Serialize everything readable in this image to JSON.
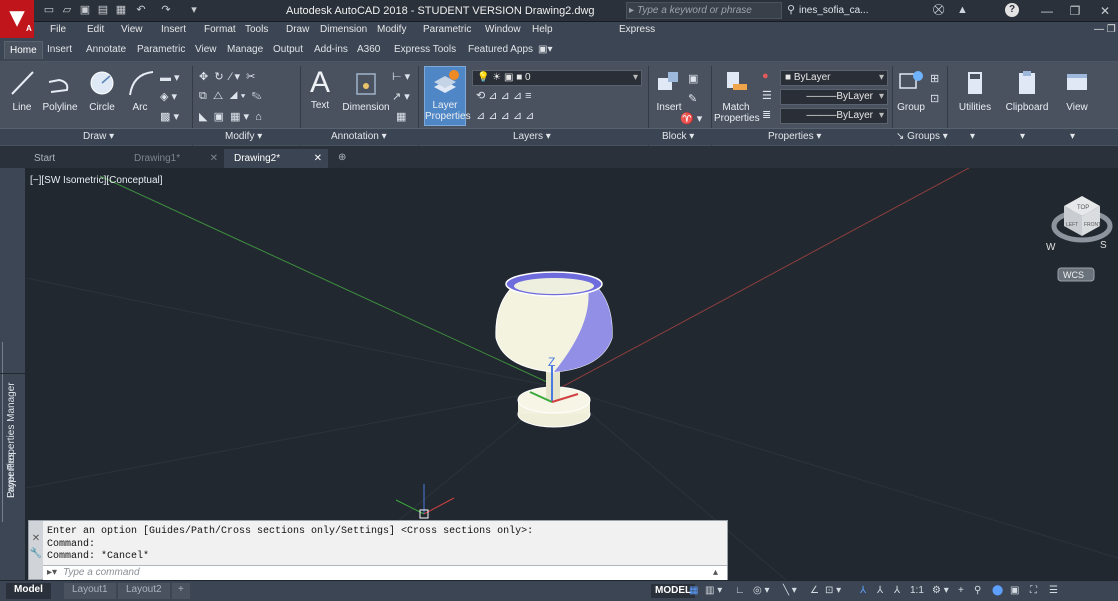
{
  "app": {
    "logo_letter": "A",
    "title": "Autodesk AutoCAD 2018 - STUDENT VERSION    Drawing2.dwg",
    "search_placeholder": "Type a keyword or phrase",
    "user": "ines_sofia_ca...",
    "help": "?"
  },
  "menu": [
    "File",
    "Edit",
    "View",
    "Insert",
    "Format",
    "Tools",
    "Draw",
    "Dimension",
    "Modify",
    "Parametric",
    "Window",
    "Help",
    "Express"
  ],
  "ribbon_tabs": [
    "Home",
    "Insert",
    "Annotate",
    "Parametric",
    "View",
    "Manage",
    "Output",
    "Add-ins",
    "A360",
    "Express Tools",
    "Featured Apps"
  ],
  "draw_tools": [
    "Line",
    "Polyline",
    "Circle",
    "Arc"
  ],
  "text_tools": [
    "Text",
    "Dimension"
  ],
  "layer_button": "Layer Properties",
  "layer_current": "0",
  "insert_button": "Insert",
  "match_button": "Match Properties",
  "properties": {
    "color": "ByLayer",
    "linetype": "ByLayer",
    "lineweight": "ByLayer"
  },
  "group_button": "Group",
  "utilities_button": "Utilities",
  "clipboard_button": "Clipboard",
  "view_button": "View",
  "panels": [
    "Draw",
    "Modify",
    "Annotation",
    "Layers",
    "Block",
    "Properties",
    "Groups"
  ],
  "doc_tabs": [
    "Start",
    "Drawing1*",
    "Drawing2*"
  ],
  "palettes": {
    "layer_manager": "Layer Properties Manager",
    "properties": "Properties"
  },
  "viewport": {
    "label": "[−][SW Isometric][Conceptual]",
    "ucs_label": "Z",
    "wcs": "WCS",
    "cube_top": "TOP",
    "cube_left": "LEFT",
    "cube_front": "FRONT",
    "compass_w": "W",
    "compass_s": "S"
  },
  "command": {
    "lines": [
      "Enter an option [Guides/Path/Cross sections only/Settings] <Cross sections only>:",
      "Command:",
      "Command: *Cancel*"
    ],
    "input_placeholder": "Type a command"
  },
  "layout_tabs": [
    "Model",
    "Layout1",
    "Layout2"
  ],
  "status": {
    "model": "MODEL",
    "scale": "1:1"
  },
  "colors": {
    "accent_red": "#c0161b",
    "viewport_bg": "#212830",
    "ribbon_bg": "#4a5260",
    "layer_button_bg": "#4f86c6"
  }
}
